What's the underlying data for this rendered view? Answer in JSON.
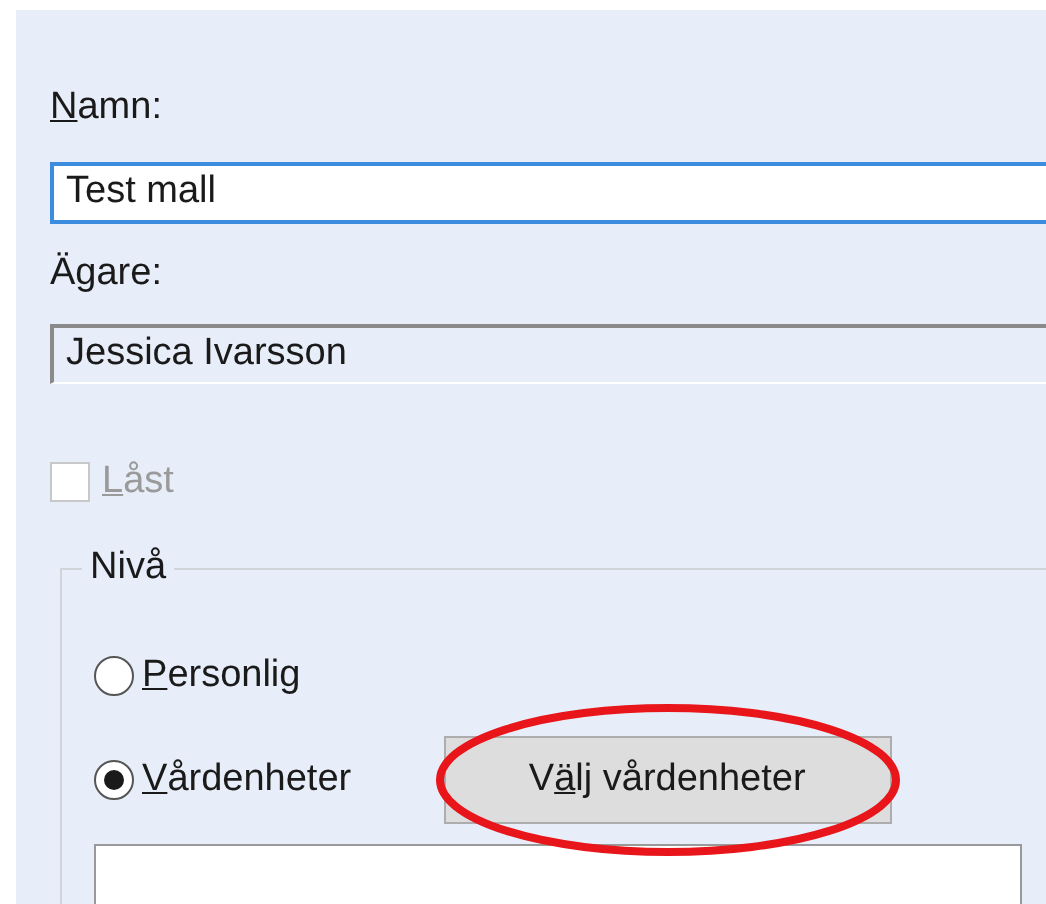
{
  "name_field": {
    "label": {
      "key": "N",
      "post": "amn:"
    },
    "value": "Test mall",
    "focused": true
  },
  "owner_field": {
    "label": {
      "post": "Ägare:"
    },
    "value": "Jessica Ivarsson",
    "readonly": true
  },
  "locked_checkbox": {
    "label": {
      "key": "L",
      "post": "åst"
    },
    "checked": false,
    "disabled": true
  },
  "level_group": {
    "legend": "Nivå",
    "options": [
      {
        "label": {
          "key": "P",
          "post": "ersonlig"
        },
        "selected": false
      },
      {
        "label": {
          "key": "V",
          "post": "årdenheter"
        },
        "selected": true
      }
    ],
    "choose_button": {
      "label": {
        "pre": "V",
        "key": "ä",
        "post": "lj vårdenheter"
      }
    }
  }
}
